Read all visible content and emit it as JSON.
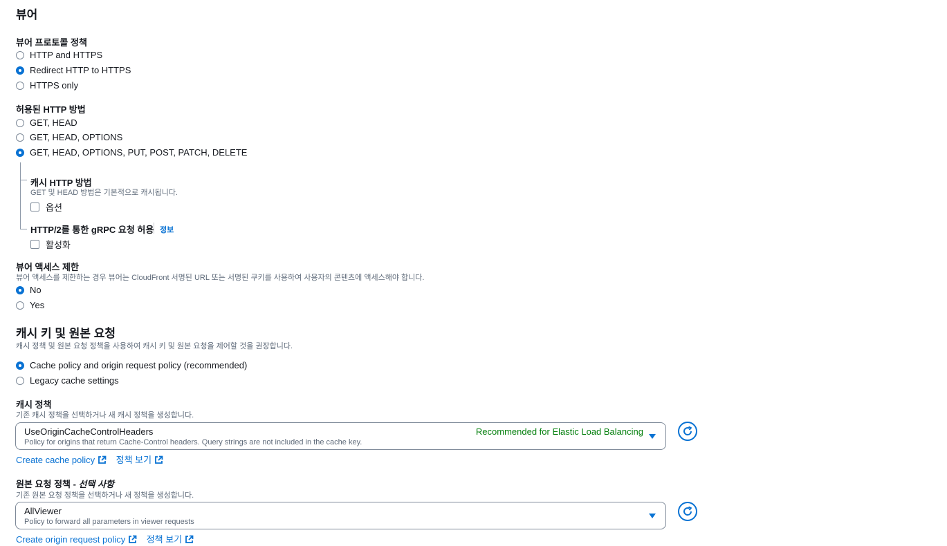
{
  "viewer": {
    "title": "뷰어",
    "protocol": {
      "label": "뷰어 프로토콜 정책",
      "options": [
        "HTTP and HTTPS",
        "Redirect HTTP to HTTPS",
        "HTTPS only"
      ],
      "selected": "Redirect HTTP to HTTPS"
    },
    "methods": {
      "label": "허용된 HTTP 방법",
      "options": [
        "GET, HEAD",
        "GET, HEAD, OPTIONS",
        "GET, HEAD, OPTIONS, PUT, POST, PATCH, DELETE"
      ],
      "selected": "GET, HEAD, OPTIONS, PUT, POST, PATCH, DELETE"
    },
    "cache_methods": {
      "label": "캐시 HTTP 방법",
      "description": "GET 및 HEAD 방법은 기본적으로 캐시됩니다.",
      "checkbox_label": "옵션",
      "checked": false
    },
    "grpc": {
      "label": "HTTP/2를 통한 gRPC 요청 허용",
      "info_link": "정보",
      "checkbox_label": "활성화",
      "checked": false
    },
    "access": {
      "label": "뷰어 액세스 제한",
      "description": "뷰어 액세스를 제한하는 경우 뷰어는 CloudFront 서명된 URL 또는 서명된 쿠키를 사용하여 사용자의 콘텐츠에 액세스해야 합니다.",
      "options": [
        "No",
        "Yes"
      ],
      "selected": "No"
    }
  },
  "cache_key": {
    "title": "캐시 키 및 원본 요청",
    "description": "캐시 정책 및 원본 요청 정책을 사용하여 캐시 키 및 원본 요청을 제어할 것을 권장합니다.",
    "options": [
      "Cache policy and origin request policy (recommended)",
      "Legacy cache settings"
    ],
    "selected": "Cache policy and origin request policy (recommended)",
    "cache_policy": {
      "label": "캐시 정책",
      "description": "기존 캐시 정책을 선택하거나 새 캐시 정책을 생성합니다.",
      "value": "UseOriginCacheControlHeaders",
      "value_description": "Policy for origins that return Cache-Control headers. Query strings are not included in the cache key.",
      "tag": "Recommended for Elastic Load Balancing",
      "create_link": "Create cache policy",
      "view_link": "정책 보기"
    },
    "origin_policy": {
      "label": "원본 요청 정책 - ",
      "label_optional": "선택 사항",
      "description": "기존 원본 요청 정책을 선택하거나 새 정책을 생성합니다.",
      "value": "AllViewer",
      "value_description": "Policy to forward all parameters in viewer requests",
      "create_link": "Create origin request policy",
      "view_link": "정책 보기"
    }
  },
  "colors": {
    "accent": "#0972d3",
    "success_text": "#037f0c",
    "muted_text": "#5f6b7a",
    "text": "#16191f"
  }
}
